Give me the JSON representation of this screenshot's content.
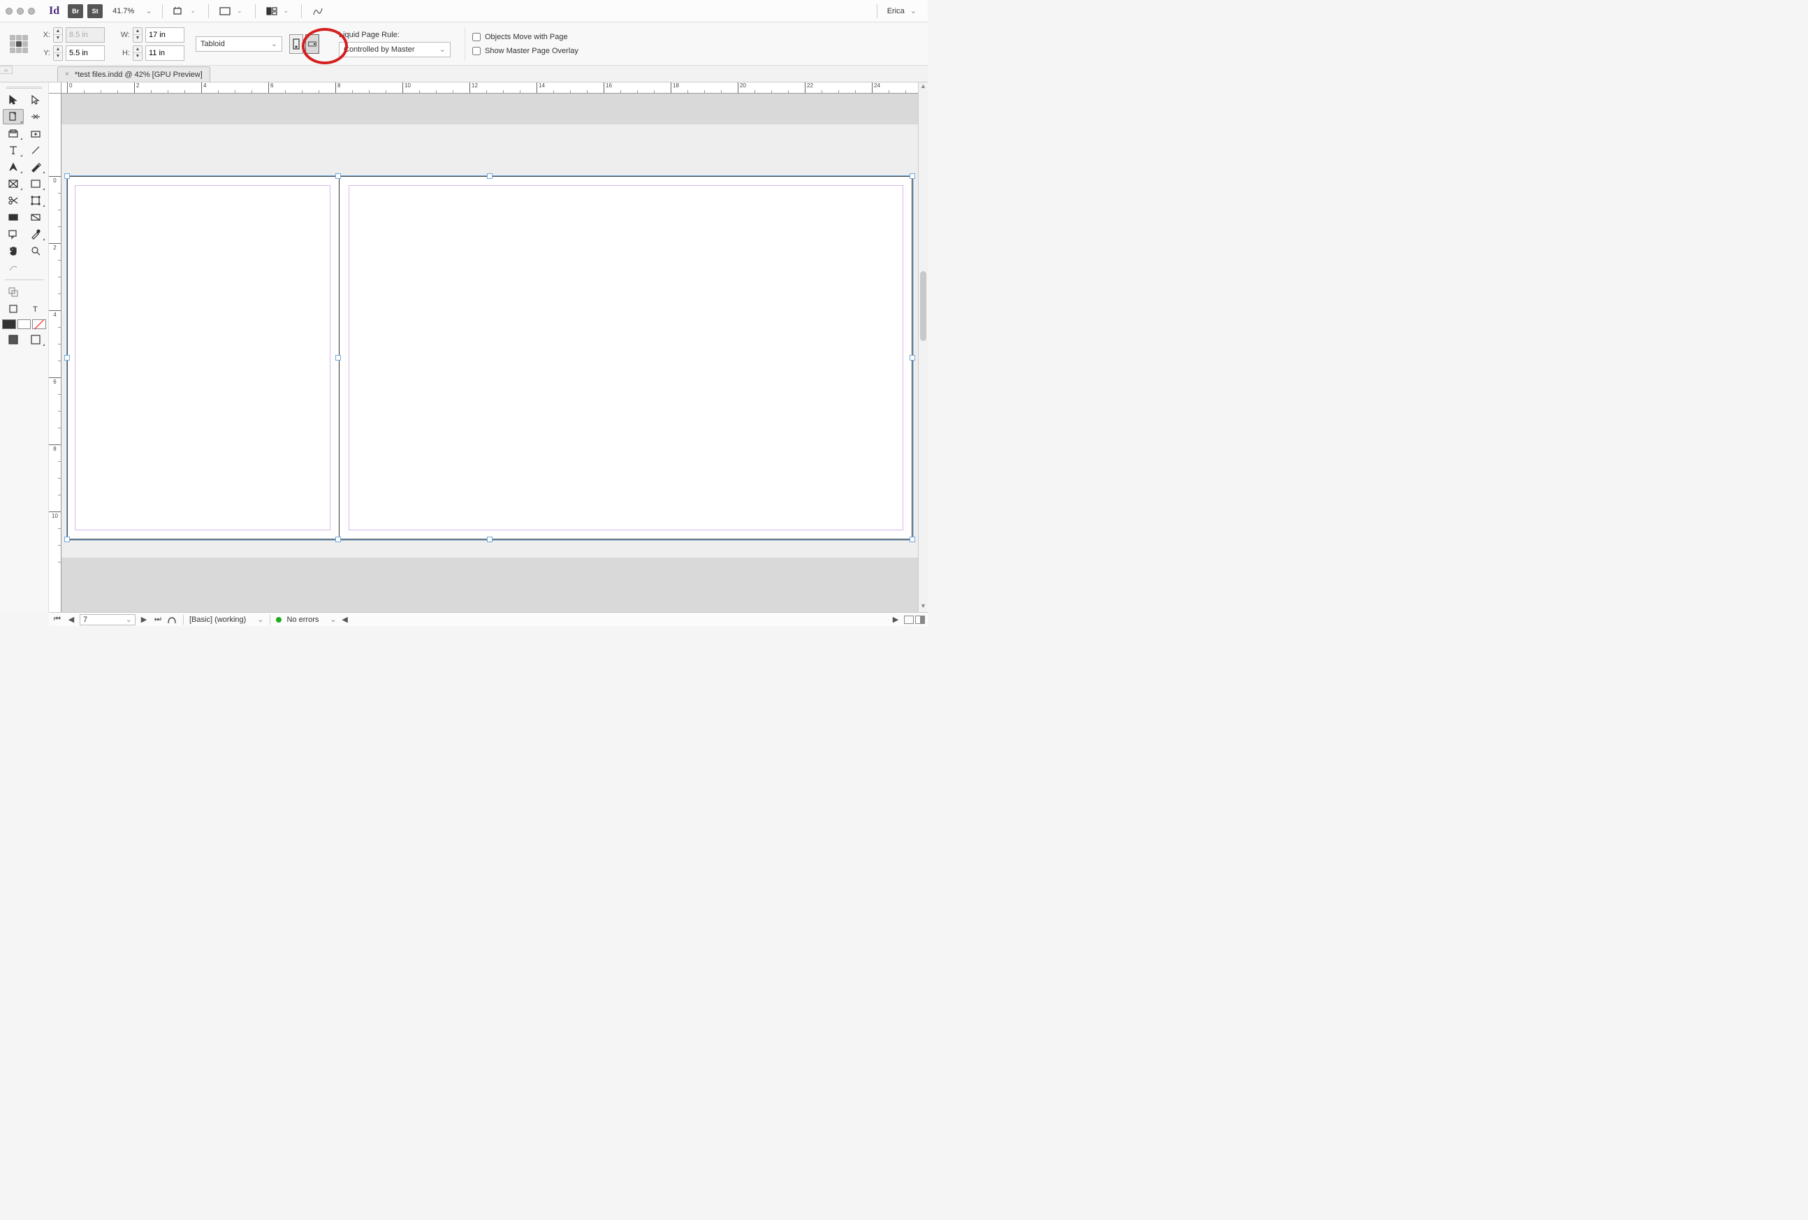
{
  "appbar": {
    "app_logo": "Id",
    "br_badge": "Br",
    "st_badge": "St",
    "zoom": "41.7%",
    "user": "Erica"
  },
  "control": {
    "x_label": "X:",
    "y_label": "Y:",
    "w_label": "W:",
    "h_label": "H:",
    "x_value": "8.5 in",
    "y_value": "5.5 in",
    "w_value": "17 in",
    "h_value": "11 in",
    "preset": "Tabloid",
    "liquid_label": "Liquid Page Rule:",
    "liquid_value": "Controlled by Master",
    "chk_objects": "Objects Move with Page",
    "chk_overlay": "Show Master Page Overlay"
  },
  "tab": {
    "title": "*test files.indd @ 42% [GPU Preview]"
  },
  "ruler_h": [
    "0",
    "2",
    "4",
    "6",
    "8",
    "10",
    "12",
    "14",
    "16",
    "18",
    "20",
    "22",
    "24"
  ],
  "ruler_v": [
    "0",
    "2",
    "4",
    "6",
    "8",
    "10"
  ],
  "status": {
    "page": "7",
    "style": "[Basic] (working)",
    "errors": "No errors"
  }
}
